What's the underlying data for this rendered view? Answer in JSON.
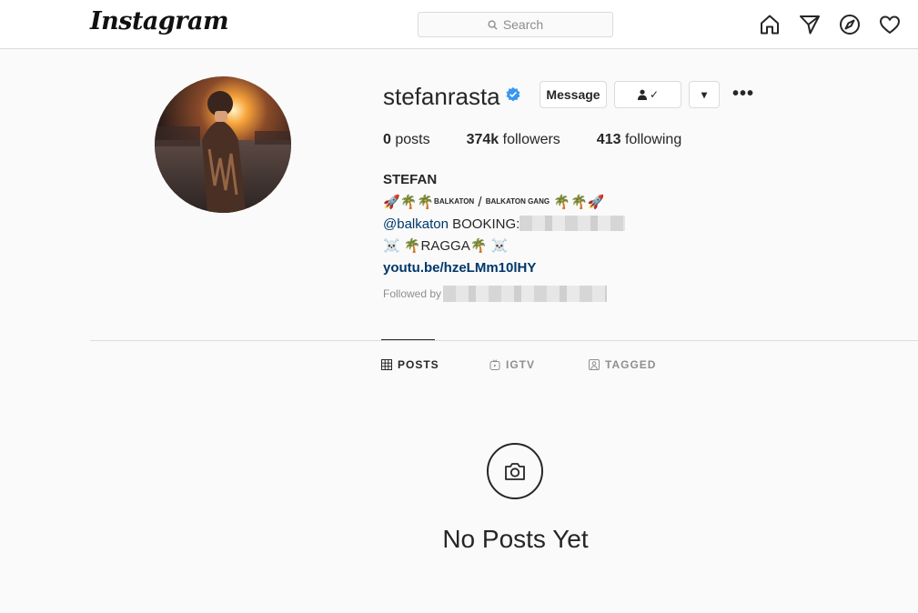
{
  "nav": {
    "logo": "Instagram",
    "search_placeholder": "Search",
    "icons": [
      "home-icon",
      "direct-icon",
      "explore-icon",
      "activity-icon"
    ]
  },
  "profile": {
    "username": "stefanrasta",
    "verified": true,
    "buttons": {
      "message": "Message",
      "following": "✓",
      "dropdown": "▾",
      "more": "•••"
    },
    "stats": [
      {
        "value": "0",
        "label": "posts"
      },
      {
        "value": "374k",
        "label": "followers"
      },
      {
        "value": "413",
        "label": "following"
      }
    ],
    "bio": {
      "name": "STEFAN",
      "line1_balkaton": "BALKATON",
      "line1_slash": " / ",
      "line1_gang": "BALKATON GANG",
      "mention": "@balkaton",
      "booking": " BOOKING:",
      "ragga": "RAGGA",
      "link": "youtu.be/hzeLMm10lHY"
    },
    "followed_by": "Followed by"
  },
  "tabs": [
    {
      "label": "POSTS",
      "active": true
    },
    {
      "label": "IGTV",
      "active": false
    },
    {
      "label": "TAGGED",
      "active": false
    }
  ],
  "empty_state": {
    "title": "No Posts Yet"
  },
  "colors": {
    "verified": "#3897f0",
    "link": "#00376b",
    "border": "#dbdbdb",
    "background": "#fafafa"
  }
}
